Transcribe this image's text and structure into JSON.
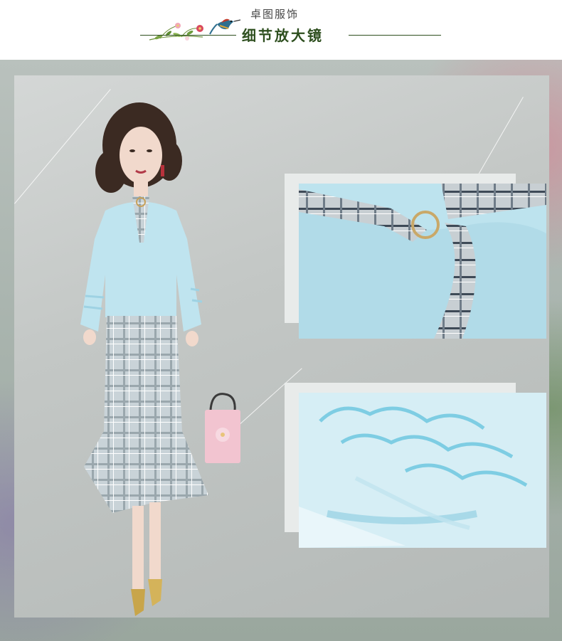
{
  "header": {
    "brand_name": "卓图服饰",
    "section_title": "细节放大镜"
  },
  "colors": {
    "title_green": "#2e4f1f",
    "brand_gray": "#444444",
    "blouse_blue": "#bfe4ef",
    "plaid_gray": "#b8c3c8",
    "bag_pink": "#f2c4d0"
  },
  "icons": {
    "header_decoration": "bird-and-flowers-icon"
  },
  "detail_panels": [
    {
      "id": "neckline-plaid-tie-with-ring"
    },
    {
      "id": "ruffled-sheer-sleeve-cuff"
    }
  ]
}
